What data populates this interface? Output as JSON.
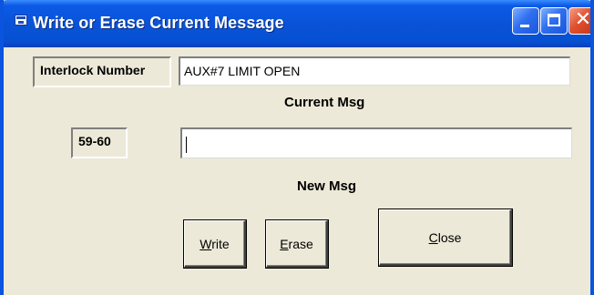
{
  "window": {
    "title": "Write or Erase Current Message",
    "controls": {
      "minimize": "minimize",
      "maximize": "maximize",
      "close": "✕"
    }
  },
  "form": {
    "interlock_label": "Interlock Number",
    "current_msg_value": "AUX#7 LIMIT OPEN",
    "current_msg_caption": "Current Msg",
    "range_label": "59-60",
    "new_msg_value": "",
    "new_msg_caption": "New Msg"
  },
  "buttons": {
    "write": {
      "accel": "W",
      "rest": "rite"
    },
    "erase": {
      "accel": "E",
      "rest": "rase"
    },
    "close": {
      "accel": "C",
      "rest": "lose"
    }
  },
  "colors": {
    "titlebar": "#0a53d8",
    "face": "#ece9d8",
    "close_button": "#e0512f"
  },
  "icons": [
    "app-icon",
    "minimize-icon",
    "maximize-icon",
    "close-icon"
  ]
}
